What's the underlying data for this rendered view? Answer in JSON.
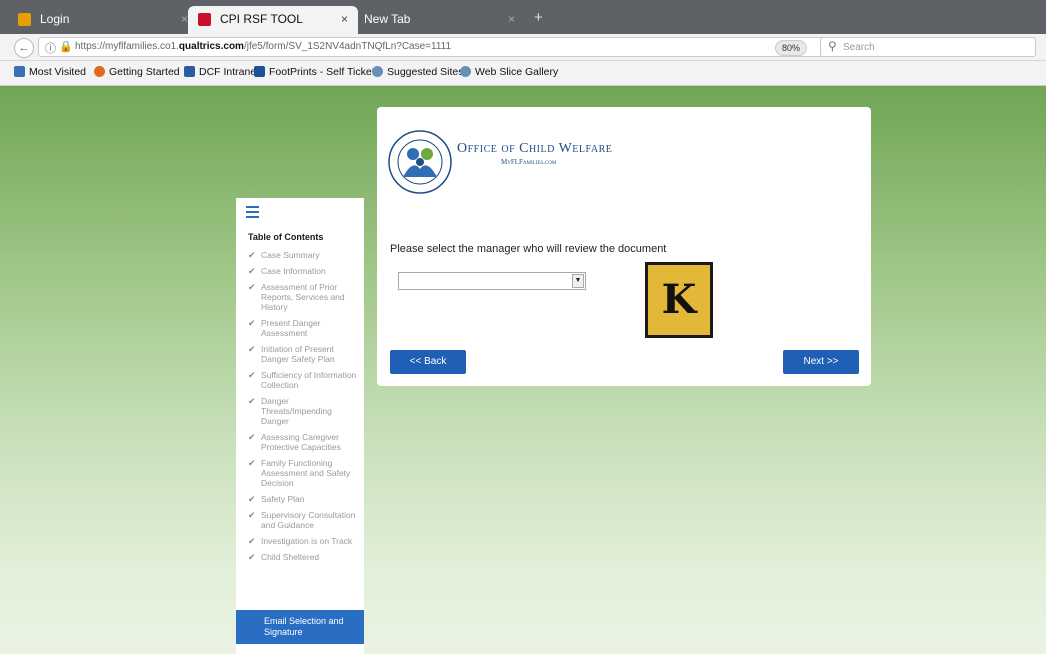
{
  "browser": {
    "tabs": [
      {
        "label": "Login",
        "active": false
      },
      {
        "label": "CPI RSF TOOL",
        "active": true
      },
      {
        "label": "New Tab",
        "active": false
      }
    ],
    "new_tab_symbol": "+",
    "close_symbol": "×",
    "url": {
      "prefix": "https://myflfamilies.co1.",
      "domain": "qualtrics.com",
      "path": "/jfe5/form/SV_1S2NV4adnTNQfLn?Case=1111"
    },
    "zoom": "80%",
    "search_placeholder": "Search",
    "bookmarks": [
      {
        "label": "Most Visited",
        "icon": "bookmark-icon",
        "color": "#3b6fb6"
      },
      {
        "label": "Getting Started",
        "icon": "firefox-icon",
        "color": "#e06a1b"
      },
      {
        "label": "DCF Intranet",
        "icon": "dcf-icon",
        "color": "#2b5aa8"
      },
      {
        "label": "FootPrints - Self Ticket",
        "icon": "footprints-icon",
        "color": "#1d4f9c"
      },
      {
        "label": "Suggested Sites",
        "icon": "globe-icon",
        "color": "#6a8fb8"
      },
      {
        "label": "Web Slice Gallery",
        "icon": "globe-icon",
        "color": "#6a8fb8"
      }
    ]
  },
  "toc": {
    "title": "Table of Contents",
    "items": [
      "Case Summary",
      "Case Information",
      "Assessment of Prior Reports, Services and History",
      "Present Danger Assessment",
      "Initiation of Present Danger Safety Plan",
      "Sufficiency of Information Collection",
      "Danger Threats/Impending Danger",
      "Assessing Caregiver Protective Capacities",
      "Family Functioning Assessment and Safety Decision",
      "Safety Plan",
      "Supervisory Consultation and Guidance",
      "Investigation is on Track",
      "Child Sheltered"
    ],
    "active_item": "Email Selection and Signature"
  },
  "form": {
    "logo_title": "Office of Child Welfare",
    "logo_subtitle": "MyFLFamilies.com",
    "prompt": "Please select the manager who will review the document",
    "select_value": "",
    "badge_letter": "K",
    "back_label": "<< Back",
    "next_label": "Next >>"
  },
  "colors": {
    "accent": "#1f5fb5",
    "badge": "#e3b838",
    "background_top": "#70a556"
  }
}
